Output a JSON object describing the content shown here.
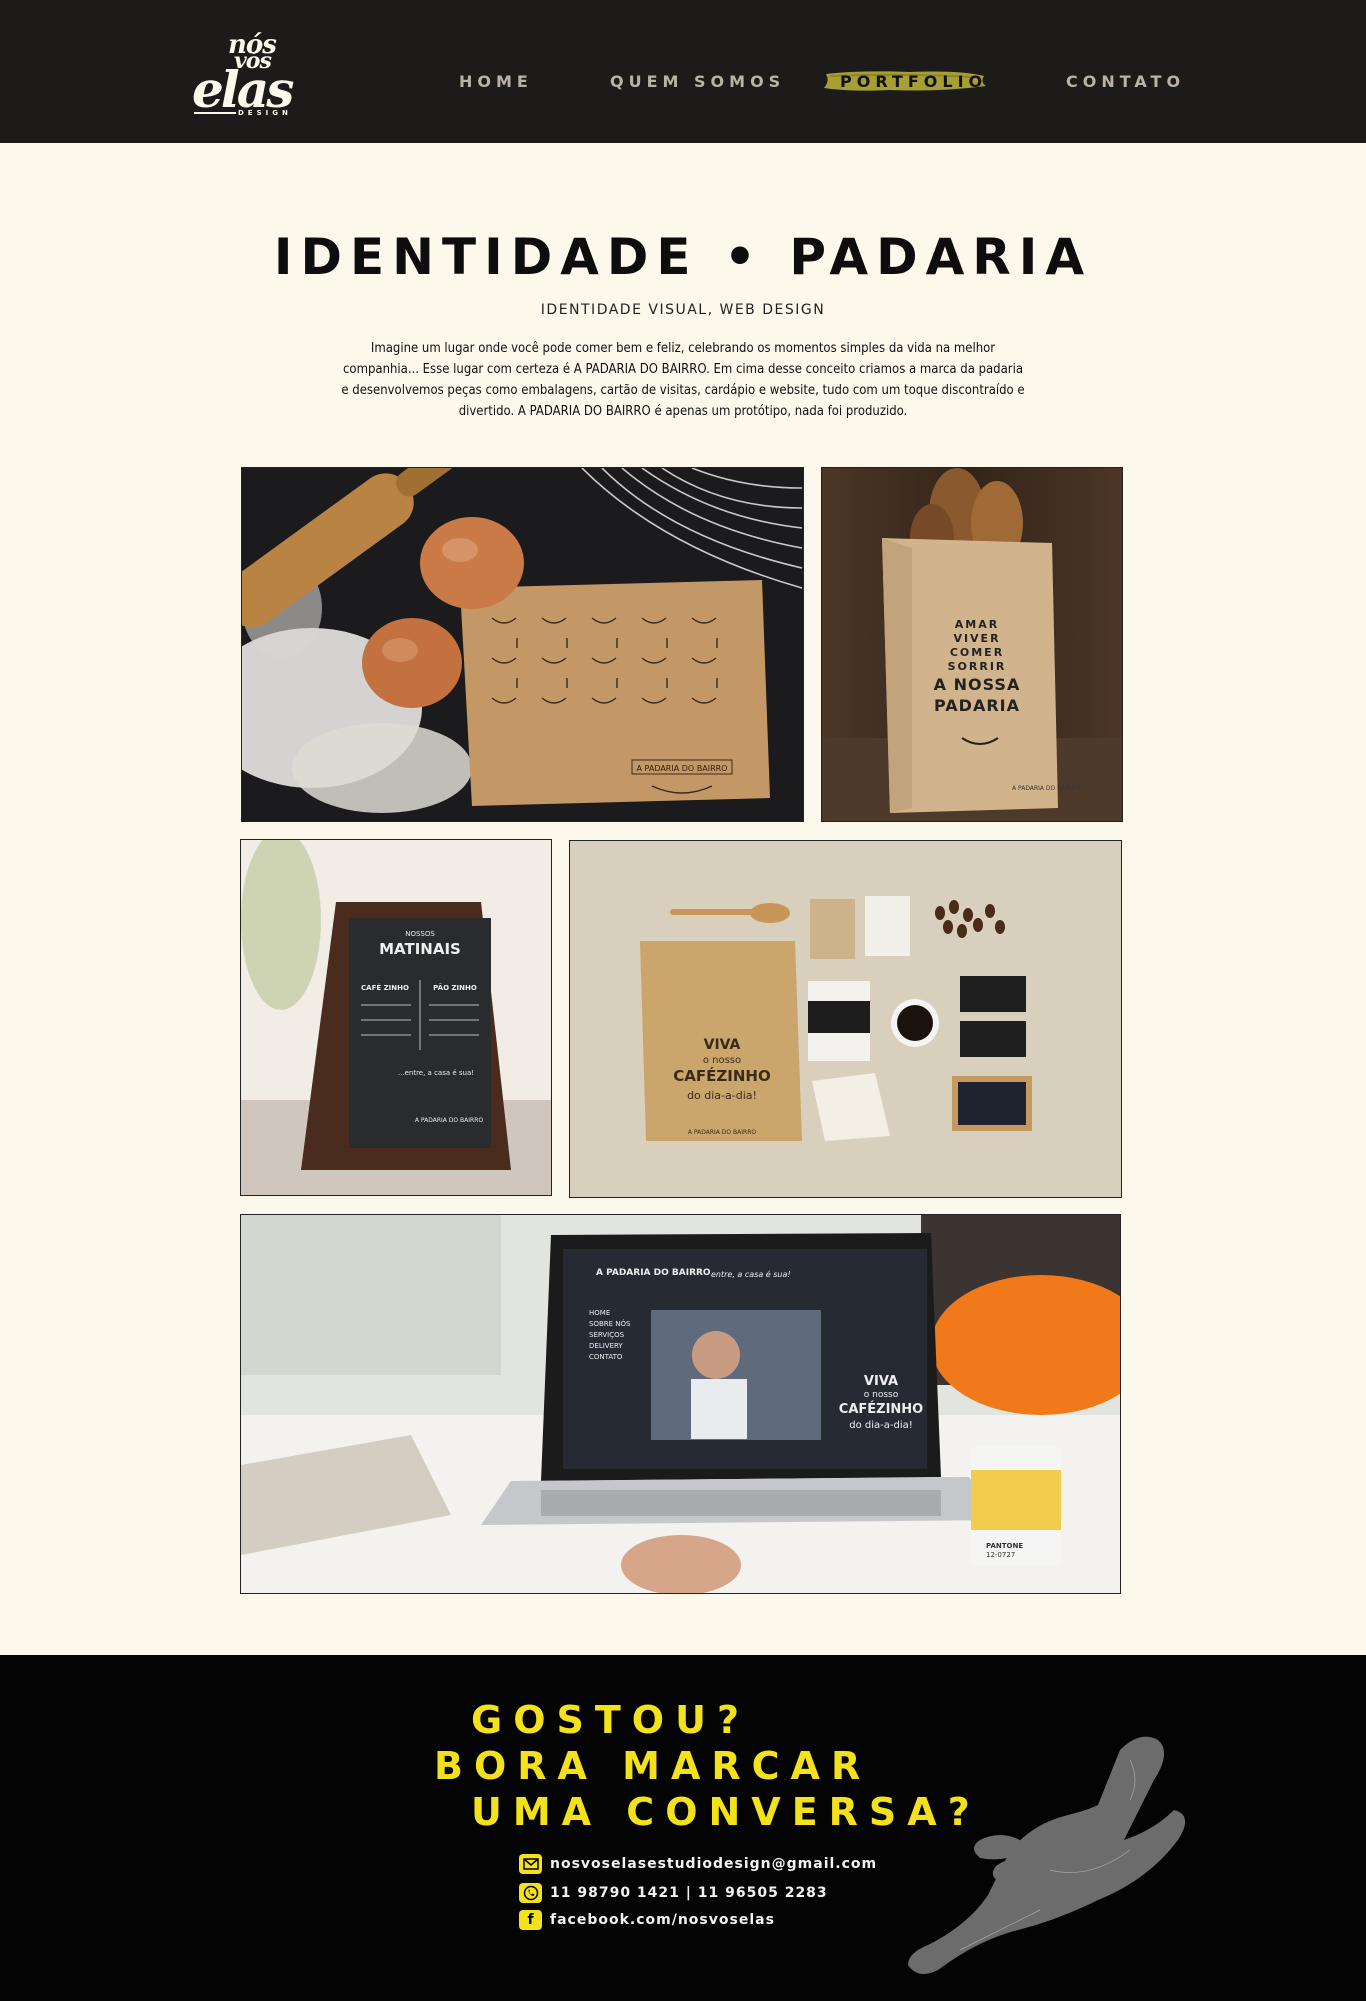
{
  "header": {
    "logo": {
      "line1": "nós",
      "line2": "vós",
      "line3": "elas",
      "tagline": "DESIGN"
    },
    "nav": [
      {
        "label": "HOME"
      },
      {
        "label": "QUEM SOMOS"
      },
      {
        "label": "PORTFOLIO",
        "active": true
      },
      {
        "label": "CONTATO"
      }
    ]
  },
  "project": {
    "title": "IDENTIDADE • PADARIA",
    "subtitle": "IDENTIDADE VISUAL, WEB DESIGN",
    "description": "Imagine um lugar onde você pode comer bem e feliz, celebrando os momentos simples da vida na melhor companhia... Esse lugar com certeza é A PADARIA DO BAIRRO. Em cima desse conceito criamos a marca da padaria e desenvolvemos peças como embalagens, cartão de visitas, cardápio e website, tudo com um toque discontraído e divertido. A PADARIA DO BAIRRO é apenas um protótipo, nada foi produzido."
  },
  "gallery": {
    "p1": {
      "brand": "A PADARIA DO BAIRRO"
    },
    "p2": {
      "bag_line1": "AMAR",
      "bag_line2": "VIVER",
      "bag_line3": "COMER",
      "bag_line4": "SORRIR",
      "bag_line5": "A NOSSA",
      "bag_line6": "PADARIA",
      "brand": "A PADARIA DO BAIRRO"
    },
    "p3": {
      "board_title1": "NOSSOS",
      "board_title2": "MATINAIS",
      "board_col1": "CAFÉ ZINHO",
      "board_col2": "PÃO ZINHO",
      "board_foot": "...entre, a casa é sua!",
      "brand": "A PADARIA DO BAIRRO"
    },
    "p4": {
      "pack1": "VIVA",
      "pack2": "o nosso",
      "pack3": "CAFÉZINHO",
      "pack4": "do dia-a-dia!",
      "brand": "A PADARIA DO BAIRRO"
    },
    "p5": {
      "site_brand": "A PADARIA DO BAIRRO",
      "site_tag": "entre, a casa é sua!",
      "site_menu": [
        "HOME",
        "SOBRE NÓS",
        "SERVIÇOS",
        "DELIVERY",
        "CONTATO"
      ],
      "hero1": "VIVA",
      "hero2": "o nosso",
      "hero3": "CAFÉZINHO",
      "hero4": "do dia-a-dia!",
      "cup_label": "PANTONE",
      "cup_code": "12-0727"
    }
  },
  "footer": {
    "cta_line1": "GOSTOU?",
    "cta_line2": "BORA MARCAR",
    "cta_line3": "UMA CONVERSA?",
    "email": "nosvoselasestudiodesign@gmail.com",
    "phone": "11 98790 1421 | 11 96505 2283",
    "facebook": "facebook.com/nosvoselas",
    "accent": "#f3e21b"
  }
}
